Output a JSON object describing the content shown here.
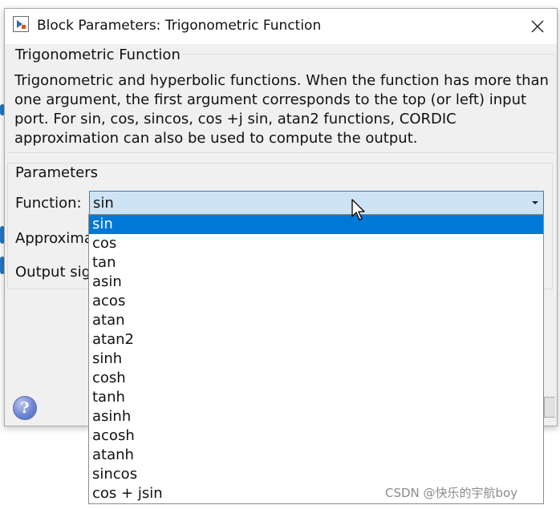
{
  "window": {
    "title": "Block Parameters: Trigonometric Function"
  },
  "block": {
    "group_title": "Trigonometric Function",
    "description": "Trigonometric and hyperbolic functions. When the function has more than one argument, the first argument corresponds to the top (or left) input port. For sin, cos, sincos, cos +j sin, atan2 functions, CORDIC approximation can also be used to compute the output."
  },
  "parameters": {
    "group_title": "Parameters",
    "function_label": "Function:",
    "function_value": "sin",
    "approximation_label": "Approxima",
    "output_label": "Output sig"
  },
  "dropdown": {
    "selected": "sin",
    "options": [
      "sin",
      "cos",
      "tan",
      "asin",
      "acos",
      "atan",
      "atan2",
      "sinh",
      "cosh",
      "tanh",
      "asinh",
      "acosh",
      "atanh",
      "sincos",
      "cos + jsin"
    ]
  },
  "help": {
    "glyph": "?"
  },
  "watermark": "CSDN @快乐的宇航boy",
  "colors": {
    "selection": "#0078d7",
    "combo_bg": "#cde4f7",
    "combo_border": "#3c7fb1",
    "dialog_bg": "#f0f0f0"
  },
  "icons": {
    "title": "simulink-block-icon",
    "close": "close-icon",
    "help": "help-icon",
    "dropdown_arrow": "chevron-down-icon",
    "cursor": "mouse-pointer-icon"
  }
}
